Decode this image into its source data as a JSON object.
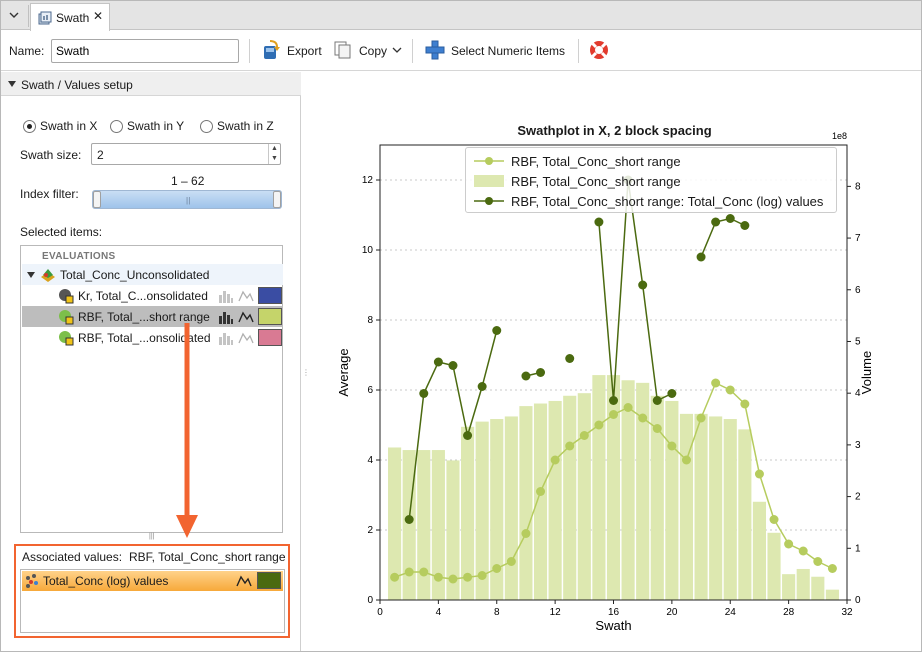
{
  "tab": {
    "title": "Swath",
    "close": "✕",
    "menu_icon": "chevron-down-icon"
  },
  "toolbar": {
    "name_label": "Name:",
    "name_value": "Swath",
    "export_label": "Export",
    "copy_label": "Copy",
    "select_label": "Select Numeric Items"
  },
  "setup": {
    "section_title": "Swath / Values setup",
    "radios": [
      {
        "label": "Swath in X",
        "selected": true
      },
      {
        "label": "Swath in Y",
        "selected": false
      },
      {
        "label": "Swath in Z",
        "selected": false
      }
    ],
    "swath_size_label": "Swath size:",
    "swath_size_value": "2",
    "index_filter_label": "Index filter:",
    "index_filter_range": "1 – 62",
    "selected_items_label": "Selected items:",
    "list_header": "EVALUATIONS",
    "group_label": "Total_Conc_Unconsolidated",
    "items": [
      {
        "label": "Kr, Total_C...onsolidated",
        "color": "#3a4da3"
      },
      {
        "label": "RBF, Total_...short range",
        "color": "#c5d46a"
      },
      {
        "label": "RBF, Total_...onsolidated",
        "color": "#d97a93"
      }
    ],
    "associated_label": "Associated values:",
    "associated_target": "RBF, Total_Conc_short range",
    "associated_item": {
      "label": "Total_Conc (log) values",
      "color": "#4b6a10"
    }
  },
  "chart_data": {
    "type": "line",
    "title": "Swathplot in X, 2 block spacing",
    "xlabel": "Swath",
    "ylabel": "Average",
    "y2label": "Volume",
    "y2_multiplier": "1e8",
    "xlim": [
      0,
      32
    ],
    "ylim": [
      0,
      13
    ],
    "y2lim": [
      0,
      8.8
    ],
    "xticks": [
      0,
      4,
      8,
      12,
      16,
      20,
      24,
      28,
      32
    ],
    "yticks": [
      0,
      2,
      4,
      6,
      8,
      10,
      12
    ],
    "y2ticks": [
      0,
      1,
      2,
      3,
      4,
      5,
      6,
      7,
      8
    ],
    "grid": "horizontal dashed",
    "legend_position": "top",
    "series": [
      {
        "name": "RBF, Total_Conc_short range",
        "kind": "line-markers",
        "axis": "left",
        "color": "#b6cc5e",
        "x": [
          1,
          2,
          3,
          4,
          5,
          6,
          7,
          8,
          9,
          10,
          11,
          12,
          13,
          14,
          15,
          16,
          17,
          18,
          19,
          20,
          21,
          22,
          23,
          24,
          25,
          26,
          27,
          28,
          29,
          30,
          31
        ],
        "y": [
          0.65,
          0.8,
          0.8,
          0.65,
          0.6,
          0.65,
          0.7,
          0.9,
          1.1,
          1.9,
          3.1,
          4.0,
          4.4,
          4.7,
          5.0,
          5.3,
          5.5,
          5.2,
          4.9,
          4.4,
          4.0,
          5.2,
          6.2,
          6.0,
          5.6,
          3.6,
          2.3,
          1.6,
          1.4,
          1.1,
          0.9
        ]
      },
      {
        "name": "RBF, Total_Conc_short range",
        "kind": "bar",
        "axis": "right",
        "color": "#dde8b0",
        "x": [
          1,
          2,
          3,
          4,
          5,
          6,
          7,
          8,
          9,
          10,
          11,
          12,
          13,
          14,
          15,
          16,
          17,
          18,
          19,
          20,
          21,
          22,
          23,
          24,
          25,
          26,
          27,
          28,
          29,
          30,
          31
        ],
        "y": [
          2.95,
          2.9,
          2.9,
          2.9,
          2.7,
          3.35,
          3.45,
          3.5,
          3.55,
          3.75,
          3.8,
          3.85,
          3.95,
          4.0,
          4.35,
          4.35,
          4.25,
          4.2,
          3.95,
          3.85,
          3.6,
          3.6,
          3.55,
          3.5,
          3.3,
          1.9,
          1.3,
          0.5,
          0.6,
          0.45,
          0.2
        ]
      },
      {
        "name": "RBF, Total_Conc_short range: Total_Conc (log) values",
        "kind": "line-markers",
        "axis": "left",
        "color": "#4b6a10",
        "x": [
          2,
          3,
          4,
          5,
          6,
          7,
          8,
          null,
          10,
          11,
          null,
          13,
          null,
          15,
          16,
          17,
          18,
          19,
          20,
          null,
          22,
          23,
          24,
          25
        ],
        "y": [
          2.3,
          5.9,
          6.8,
          6.7,
          4.7,
          6.1,
          7.7,
          null,
          6.4,
          6.5,
          null,
          6.9,
          null,
          10.8,
          5.7,
          12.0,
          9.0,
          5.7,
          5.9,
          null,
          9.8,
          10.8,
          10.9,
          10.7
        ]
      }
    ]
  }
}
